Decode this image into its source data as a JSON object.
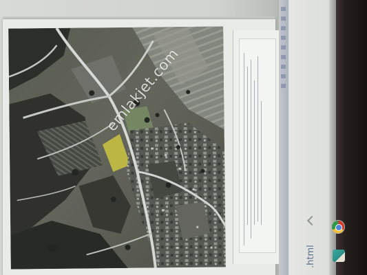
{
  "listing": {
    "watermark": "emlakjet.com",
    "info_text_visible": false
  },
  "browser": {
    "file_label": ".html"
  },
  "icons": {
    "browser_app": "chrome-icon",
    "maps_app": "maps-icon",
    "scroll": "chevron-icon"
  },
  "colors": {
    "page_background": "#e9ebe8",
    "bezel": "#1c1817",
    "watermark": "#ffffff",
    "link_blue": "#5b6f8c"
  }
}
